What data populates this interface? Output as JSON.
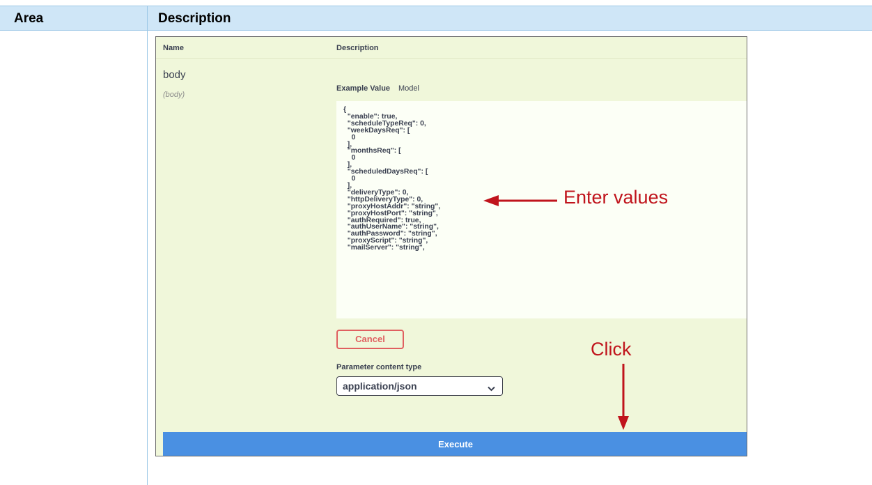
{
  "doc_table": {
    "headers": {
      "area": "Area",
      "description": "Description"
    }
  },
  "swagger": {
    "columns": {
      "name": "Name",
      "description": "Description"
    },
    "param": {
      "name": "body",
      "in": "(body)"
    },
    "tabs": {
      "example": "Example Value",
      "model": "Model"
    },
    "example_json": "{\n  \"enable\": true,\n  \"scheduleTypeReq\": 0,\n  \"weekDaysReq\": [\n    0\n  ],\n  \"monthsReq\": [\n    0\n  ],\n  \"scheduledDaysReq\": [\n    0\n  ],\n  \"deliveryType\": 0,\n  \"httpDeliveryType\": 0,\n  \"proxyHostAddr\": \"string\",\n  \"proxyHostPort\": \"string\",\n  \"authRequired\": true,\n  \"authUserName\": \"string\",\n  \"authPassword\": \"string\",\n  \"proxyScript\": \"string\",\n  \"mailServer\": \"string\",",
    "cancel_label": "Cancel",
    "content_type_label": "Parameter content type",
    "content_type_value": "application/json",
    "execute_label": "Execute"
  },
  "annotations": {
    "enter_values": "Enter values",
    "click": "Click",
    "color": "#c0141c"
  },
  "colors": {
    "header_bg": "#cfe6f7",
    "panel_bg": "#f0f7da",
    "execute_bg": "#4a90e2",
    "cancel_border": "#e06060"
  },
  "icons": {
    "select_chevron": "chevron-down-icon"
  }
}
